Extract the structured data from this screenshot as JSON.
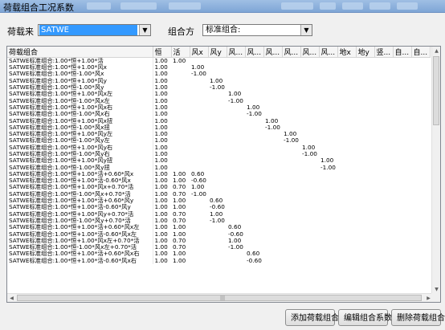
{
  "window": {
    "title": "荷载组合工况系数"
  },
  "load_source": {
    "label": "荷载来",
    "value": "SATWE"
  },
  "combo_method": {
    "label": "组合方",
    "value": "标准组合:"
  },
  "table": {
    "headers": [
      "荷载组合",
      "恒",
      "活",
      "风x",
      "风y",
      "风...",
      "风...",
      "风...",
      "风...",
      "风...",
      "风...",
      "地x",
      "地y",
      "竖...",
      "自...",
      "自..."
    ],
    "rows": [
      [
        "SATWE标准组合:1.00*恒+1.00*活",
        "1.00",
        "1.00",
        "",
        "",
        "",
        "",
        "",
        "",
        "",
        "",
        "",
        "",
        "",
        "",
        ""
      ],
      [
        "SATWE标准组合:1.00*恒+1.00*风x",
        "1.00",
        "",
        "1.00",
        "",
        "",
        "",
        "",
        "",
        "",
        "",
        "",
        "",
        "",
        "",
        ""
      ],
      [
        "SATWE标准组合:1.00*恒-1.00*风x",
        "1.00",
        "",
        "-1.00",
        "",
        "",
        "",
        "",
        "",
        "",
        "",
        "",
        "",
        "",
        "",
        ""
      ],
      [
        "SATWE标准组合:1.00*恒+1.00*风y",
        "1.00",
        "",
        "",
        "1.00",
        "",
        "",
        "",
        "",
        "",
        "",
        "",
        "",
        "",
        "",
        ""
      ],
      [
        "SATWE标准组合:1.00*恒-1.00*风y",
        "1.00",
        "",
        "",
        "-1.00",
        "",
        "",
        "",
        "",
        "",
        "",
        "",
        "",
        "",
        "",
        ""
      ],
      [
        "SATWE标准组合:1.00*恒+1.00*风x左",
        "1.00",
        "",
        "",
        "",
        "1.00",
        "",
        "",
        "",
        "",
        "",
        "",
        "",
        "",
        "",
        ""
      ],
      [
        "SATWE标准组合:1.00*恒-1.00*风x左",
        "1.00",
        "",
        "",
        "",
        "-1.00",
        "",
        "",
        "",
        "",
        "",
        "",
        "",
        "",
        "",
        ""
      ],
      [
        "SATWE标准组合:1.00*恒+1.00*风x右",
        "1.00",
        "",
        "",
        "",
        "",
        "1.00",
        "",
        "",
        "",
        "",
        "",
        "",
        "",
        "",
        ""
      ],
      [
        "SATWE标准组合:1.00*恒-1.00*风x右",
        "1.00",
        "",
        "",
        "",
        "",
        "-1.00",
        "",
        "",
        "",
        "",
        "",
        "",
        "",
        "",
        ""
      ],
      [
        "SATWE标准组合:1.00*恒+1.00*风x扭",
        "1.00",
        "",
        "",
        "",
        "",
        "",
        "1.00",
        "",
        "",
        "",
        "",
        "",
        "",
        "",
        ""
      ],
      [
        "SATWE标准组合:1.00*恒-1.00*风x扭",
        "1.00",
        "",
        "",
        "",
        "",
        "",
        "-1.00",
        "",
        "",
        "",
        "",
        "",
        "",
        "",
        ""
      ],
      [
        "SATWE标准组合:1.00*恒+1.00*风y左",
        "1.00",
        "",
        "",
        "",
        "",
        "",
        "",
        "1.00",
        "",
        "",
        "",
        "",
        "",
        "",
        ""
      ],
      [
        "SATWE标准组合:1.00*恒-1.00*风y左",
        "1.00",
        "",
        "",
        "",
        "",
        "",
        "",
        "-1.00",
        "",
        "",
        "",
        "",
        "",
        "",
        ""
      ],
      [
        "SATWE标准组合:1.00*恒+1.00*风y右",
        "1.00",
        "",
        "",
        "",
        "",
        "",
        "",
        "",
        "1.00",
        "",
        "",
        "",
        "",
        "",
        ""
      ],
      [
        "SATWE标准组合:1.00*恒-1.00*风y右",
        "1.00",
        "",
        "",
        "",
        "",
        "",
        "",
        "",
        "-1.00",
        "",
        "",
        "",
        "",
        "",
        ""
      ],
      [
        "SATWE标准组合:1.00*恒+1.00*风y扭",
        "1.00",
        "",
        "",
        "",
        "",
        "",
        "",
        "",
        "",
        "1.00",
        "",
        "",
        "",
        "",
        ""
      ],
      [
        "SATWE标准组合:1.00*恒-1.00*风y扭",
        "1.00",
        "",
        "",
        "",
        "",
        "",
        "",
        "",
        "",
        "-1.00",
        "",
        "",
        "",
        "",
        ""
      ],
      [
        "SATWE标准组合:1.00*恒+1.00*活+0.60*风x",
        "1.00",
        "1.00",
        "0.60",
        "",
        "",
        "",
        "",
        "",
        "",
        "",
        "",
        "",
        "",
        "",
        ""
      ],
      [
        "SATWE标准组合:1.00*恒+1.00*活-0.60*风x",
        "1.00",
        "1.00",
        "-0.60",
        "",
        "",
        "",
        "",
        "",
        "",
        "",
        "",
        "",
        "",
        "",
        ""
      ],
      [
        "SATWE标准组合:1.00*恒+1.00*风x+0.70*活",
        "1.00",
        "0.70",
        "1.00",
        "",
        "",
        "",
        "",
        "",
        "",
        "",
        "",
        "",
        "",
        "",
        ""
      ],
      [
        "SATWE标准组合:1.00*恒-1.00*风x+0.70*活",
        "1.00",
        "0.70",
        "-1.00",
        "",
        "",
        "",
        "",
        "",
        "",
        "",
        "",
        "",
        "",
        "",
        ""
      ],
      [
        "SATWE标准组合:1.00*恒+1.00*活+0.60*风y",
        "1.00",
        "1.00",
        "",
        "0.60",
        "",
        "",
        "",
        "",
        "",
        "",
        "",
        "",
        "",
        "",
        ""
      ],
      [
        "SATWE标准组合:1.00*恒+1.00*活-0.60*风y",
        "1.00",
        "1.00",
        "",
        "-0.60",
        "",
        "",
        "",
        "",
        "",
        "",
        "",
        "",
        "",
        "",
        ""
      ],
      [
        "SATWE标准组合:1.00*恒+1.00*风y+0.70*活",
        "1.00",
        "0.70",
        "",
        "1.00",
        "",
        "",
        "",
        "",
        "",
        "",
        "",
        "",
        "",
        "",
        ""
      ],
      [
        "SATWE标准组合:1.00*恒-1.00*风y+0.70*活",
        "1.00",
        "0.70",
        "",
        "-1.00",
        "",
        "",
        "",
        "",
        "",
        "",
        "",
        "",
        "",
        "",
        ""
      ],
      [
        "SATWE标准组合:1.00*恒+1.00*活+0.60*风x左",
        "1.00",
        "1.00",
        "",
        "",
        "0.60",
        "",
        "",
        "",
        "",
        "",
        "",
        "",
        "",
        "",
        ""
      ],
      [
        "SATWE标准组合:1.00*恒+1.00*活-0.60*风x左",
        "1.00",
        "1.00",
        "",
        "",
        "-0.60",
        "",
        "",
        "",
        "",
        "",
        "",
        "",
        "",
        "",
        ""
      ],
      [
        "SATWE标准组合:1.00*恒+1.00*风x左+0.70*活",
        "1.00",
        "0.70",
        "",
        "",
        "1.00",
        "",
        "",
        "",
        "",
        "",
        "",
        "",
        "",
        "",
        ""
      ],
      [
        "SATWE标准组合:1.00*恒-1.00*风x左+0.70*活",
        "1.00",
        "0.70",
        "",
        "",
        "-1.00",
        "",
        "",
        "",
        "",
        "",
        "",
        "",
        "",
        "",
        ""
      ],
      [
        "SATWE标准组合:1.00*恒+1.00*活+0.60*风x右",
        "1.00",
        "1.00",
        "",
        "",
        "",
        "0.60",
        "",
        "",
        "",
        "",
        "",
        "",
        "",
        "",
        ""
      ],
      [
        "SATWE标准组合:1.00*恒+1.00*活-0.60*风x右",
        "1.00",
        "1.00",
        "",
        "",
        "",
        "-0.60",
        "",
        "",
        "",
        "",
        "",
        "",
        "",
        "",
        ""
      ]
    ]
  },
  "buttons": {
    "add": "添加荷载组合",
    "edit": "编辑组合系数",
    "delete": "删除荷载组合"
  },
  "icons": {
    "dropdown": "chevron-down-icon",
    "scroll_up": "arrow-up-icon",
    "scroll_down": "arrow-down-icon",
    "scroll_left": "arrow-left-icon",
    "scroll_right": "arrow-right-icon"
  },
  "colors": {
    "selection": "#3399ff",
    "window_bg": "#f0f0f0",
    "titlebar": "#8fb2de"
  }
}
